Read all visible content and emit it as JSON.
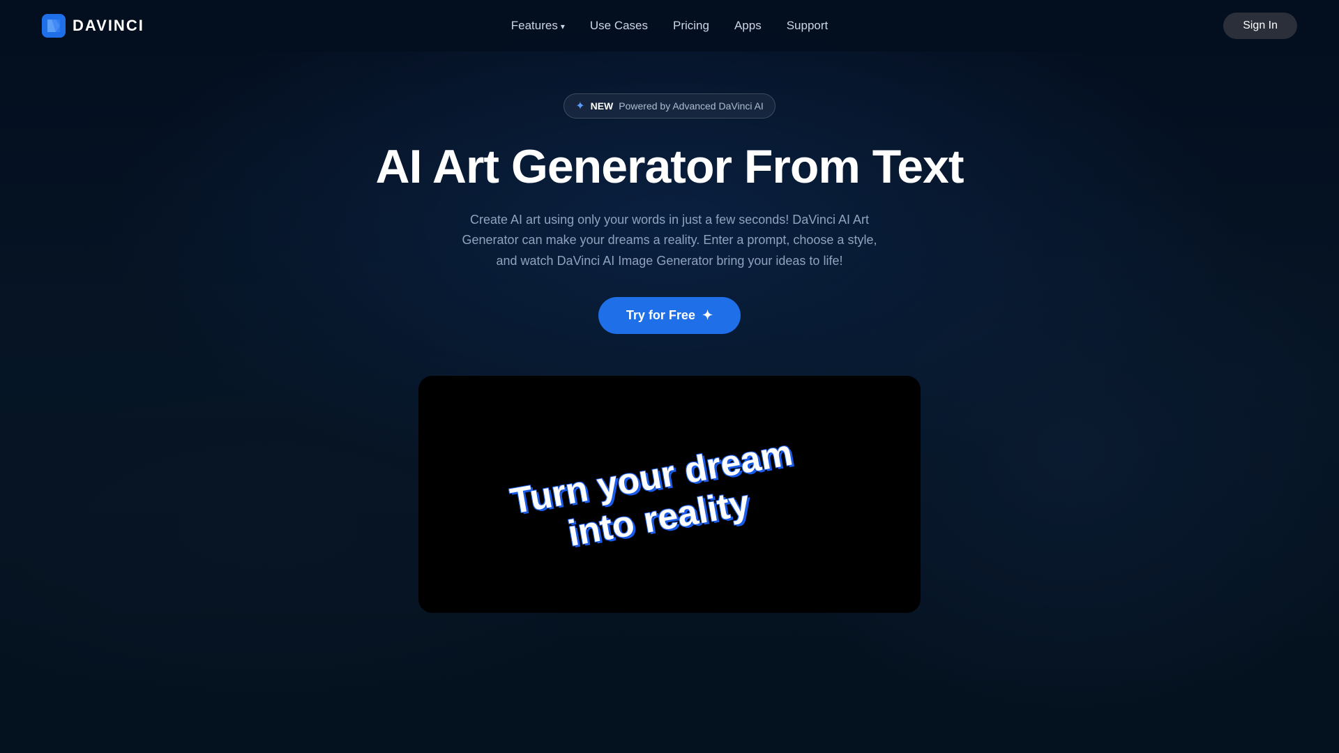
{
  "brand": {
    "name": "DAVINCI",
    "logo_alt": "DaVinci Logo"
  },
  "navbar": {
    "links": [
      {
        "id": "features",
        "label": "Features",
        "has_dropdown": true
      },
      {
        "id": "use-cases",
        "label": "Use Cases",
        "has_dropdown": false
      },
      {
        "id": "pricing",
        "label": "Pricing",
        "has_dropdown": false
      },
      {
        "id": "apps",
        "label": "Apps",
        "has_dropdown": false
      },
      {
        "id": "support",
        "label": "Support",
        "has_dropdown": false
      }
    ],
    "sign_in_label": "Sign In"
  },
  "hero": {
    "badge": {
      "spark_icon": "✦",
      "new_label": "NEW",
      "description": "Powered by Advanced DaVinci AI"
    },
    "title": "AI Art Generator From Text",
    "subtitle": "Create AI art using only your words in just a few seconds! DaVinci AI Art Generator can make your dreams a reality. Enter a prompt, choose a style, and watch DaVinci AI Image Generator bring your ideas to life!",
    "cta_label": "Try for Free",
    "cta_icon": "✦"
  },
  "demo": {
    "line1": "Turn your dream",
    "line2": "into reality"
  },
  "colors": {
    "accent": "#1e6fe8",
    "bg_dark": "#040e1f"
  }
}
